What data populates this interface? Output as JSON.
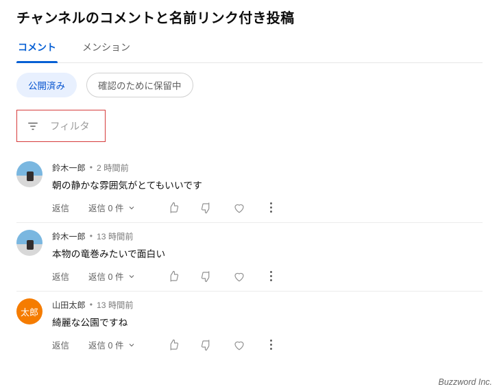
{
  "page": {
    "title": "チャンネルのコメントと名前リンク付き投稿"
  },
  "tabs": [
    {
      "label": "コメント",
      "active": true
    },
    {
      "label": "メンション",
      "active": false
    }
  ],
  "statusChips": [
    {
      "label": "公開済み",
      "active": true
    },
    {
      "label": "確認のために保留中",
      "active": false
    }
  ],
  "filter": {
    "label": "フィルタ"
  },
  "commonActions": {
    "reply": "返信",
    "repliesPrefix": "返信",
    "repliesSuffix": "件"
  },
  "comments": [
    {
      "author": "鈴木一郎",
      "timestamp": "2 時間前",
      "text": "朝の静かな雰囲気がとてもいいです",
      "replyCount": "0",
      "avatarType": "photo"
    },
    {
      "author": "鈴木一郎",
      "timestamp": "13 時間前",
      "text": "本物の竜巻みたいで面白い",
      "replyCount": "0",
      "avatarType": "photo"
    },
    {
      "author": "山田太郎",
      "timestamp": "13 時間前",
      "text": "綺麗な公園ですね",
      "replyCount": "0",
      "avatarType": "letter",
      "avatarLetters": "太郎"
    }
  ],
  "footer": {
    "attribution": "Buzzword Inc."
  }
}
